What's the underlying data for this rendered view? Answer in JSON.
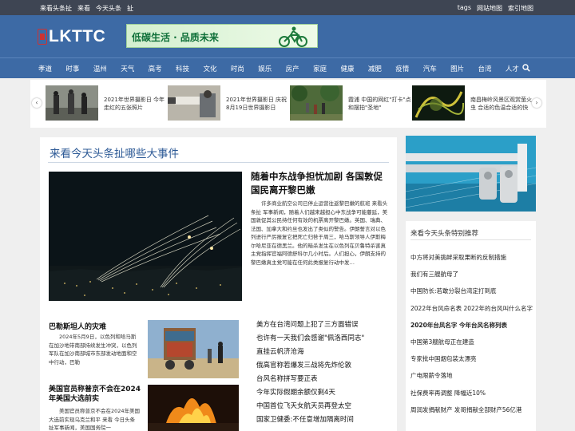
{
  "topbar": {
    "left": [
      "来看头条扯",
      "来看",
      "今天头条",
      "扯"
    ],
    "right": [
      "tags",
      "网站地图",
      "索引地图"
    ]
  },
  "logo": {
    "text": "LKTTC"
  },
  "banner": {
    "text": "低碳生活 · 品质未来"
  },
  "nav": {
    "items": [
      "孝道",
      "时事",
      "温州",
      "天气",
      "高考",
      "科技",
      "文化",
      "时尚",
      "娱乐",
      "房产",
      "家庭",
      "健康",
      "减肥",
      "疫情",
      "汽车",
      "图片",
      "台湾",
      "人才"
    ]
  },
  "carousel": {
    "items": [
      {
        "caption": "2021年世界摄影日 今年走红的五张照片"
      },
      {
        "caption": "2021年世界摄影日 庆祝8月19日世界摄影日"
      },
      {
        "caption": "霞浦 中国的网红\"打卡\"点和摆拍\"圣地\""
      },
      {
        "caption": "南昌梅岭风景区观赏萤火虫 合适的色温合适的快"
      }
    ]
  },
  "main": {
    "section_title": "来看今天头条扯哪些大事件",
    "hero": {
      "title": "随着中东战争担忧加剧 各国敦促国民离开黎巴嫩",
      "summary": "许多商业航空公司已停止运营往返黎巴嫩的航班 来看头条扯 军事新闻，随着人们越来越担心中东战争可能蔓延，美国敦促其公民持任何有效的机票离开黎巴嫩。英国、瑞典、法国、加拿大和约旦也发出了类似的警告。伊朗誓言对以色列进行严厉报复它把死亡归咎于周三，哈马斯领导人伊斯梅尔哈尼亚在德黑兰。他的暗杀发生在以色列在贝鲁特杀害真主党指挥官福阿德舒科尔几小时后。人们担心，伊朗支持的黎巴嫩真主党可能在任何此类报复行动中发…"
    },
    "sub1": {
      "title": "巴勒斯坦人的灾难",
      "summary": "2024年5月9日，以色列和哈马斯在加沙地带南部持续发生冲突，以色列军队在加沙南部城市东部发动地面和空中行动，巴勒"
    },
    "sub2": {
      "title": "美国官员称普京不会在2024年美国大选前实",
      "summary": "美国官员称普京不会在2024年美国大选前实现乌克兰和平 来看 今日头条 扯军事新闻，美国国务院一"
    },
    "list": [
      "美方在台湾问题上犯了三方面错误",
      "也许有一天我们会感谢\"佩洛西同志\"",
      "直挂云帆济沧海",
      "俄高官称若爆发三战将先炸伦敦",
      "台风名称拼写要正表",
      "今年实际假期余额仅剩4天",
      "中国首位飞天女航天员再登太空",
      "国家卫健委:不任意增加隔离时间"
    ]
  },
  "sidebar": {
    "title": "来看今天头条特别推荐",
    "items": [
      "中方将对美挑衅采取果断的反制措施",
      "我们有三艘航母了",
      "中国防长:若敢分裂台湾定打到底",
      "2022年台风命名表 2022年的台风叫什么名字",
      "2020年台风名字 今年台风名称列表",
      "中国第3艘航母正在建造",
      "专家批中国烟包装太漂亮",
      "广电限薪令落地",
      "社保费率再调整 降幅近10%",
      "周润发捐献财产 发哥捐献全部财产56亿港"
    ],
    "bold_index": 4
  },
  "colors": {
    "brand": "#3d6aa5",
    "topbar": "#3e4553",
    "title_blue": "#2d5a96"
  }
}
